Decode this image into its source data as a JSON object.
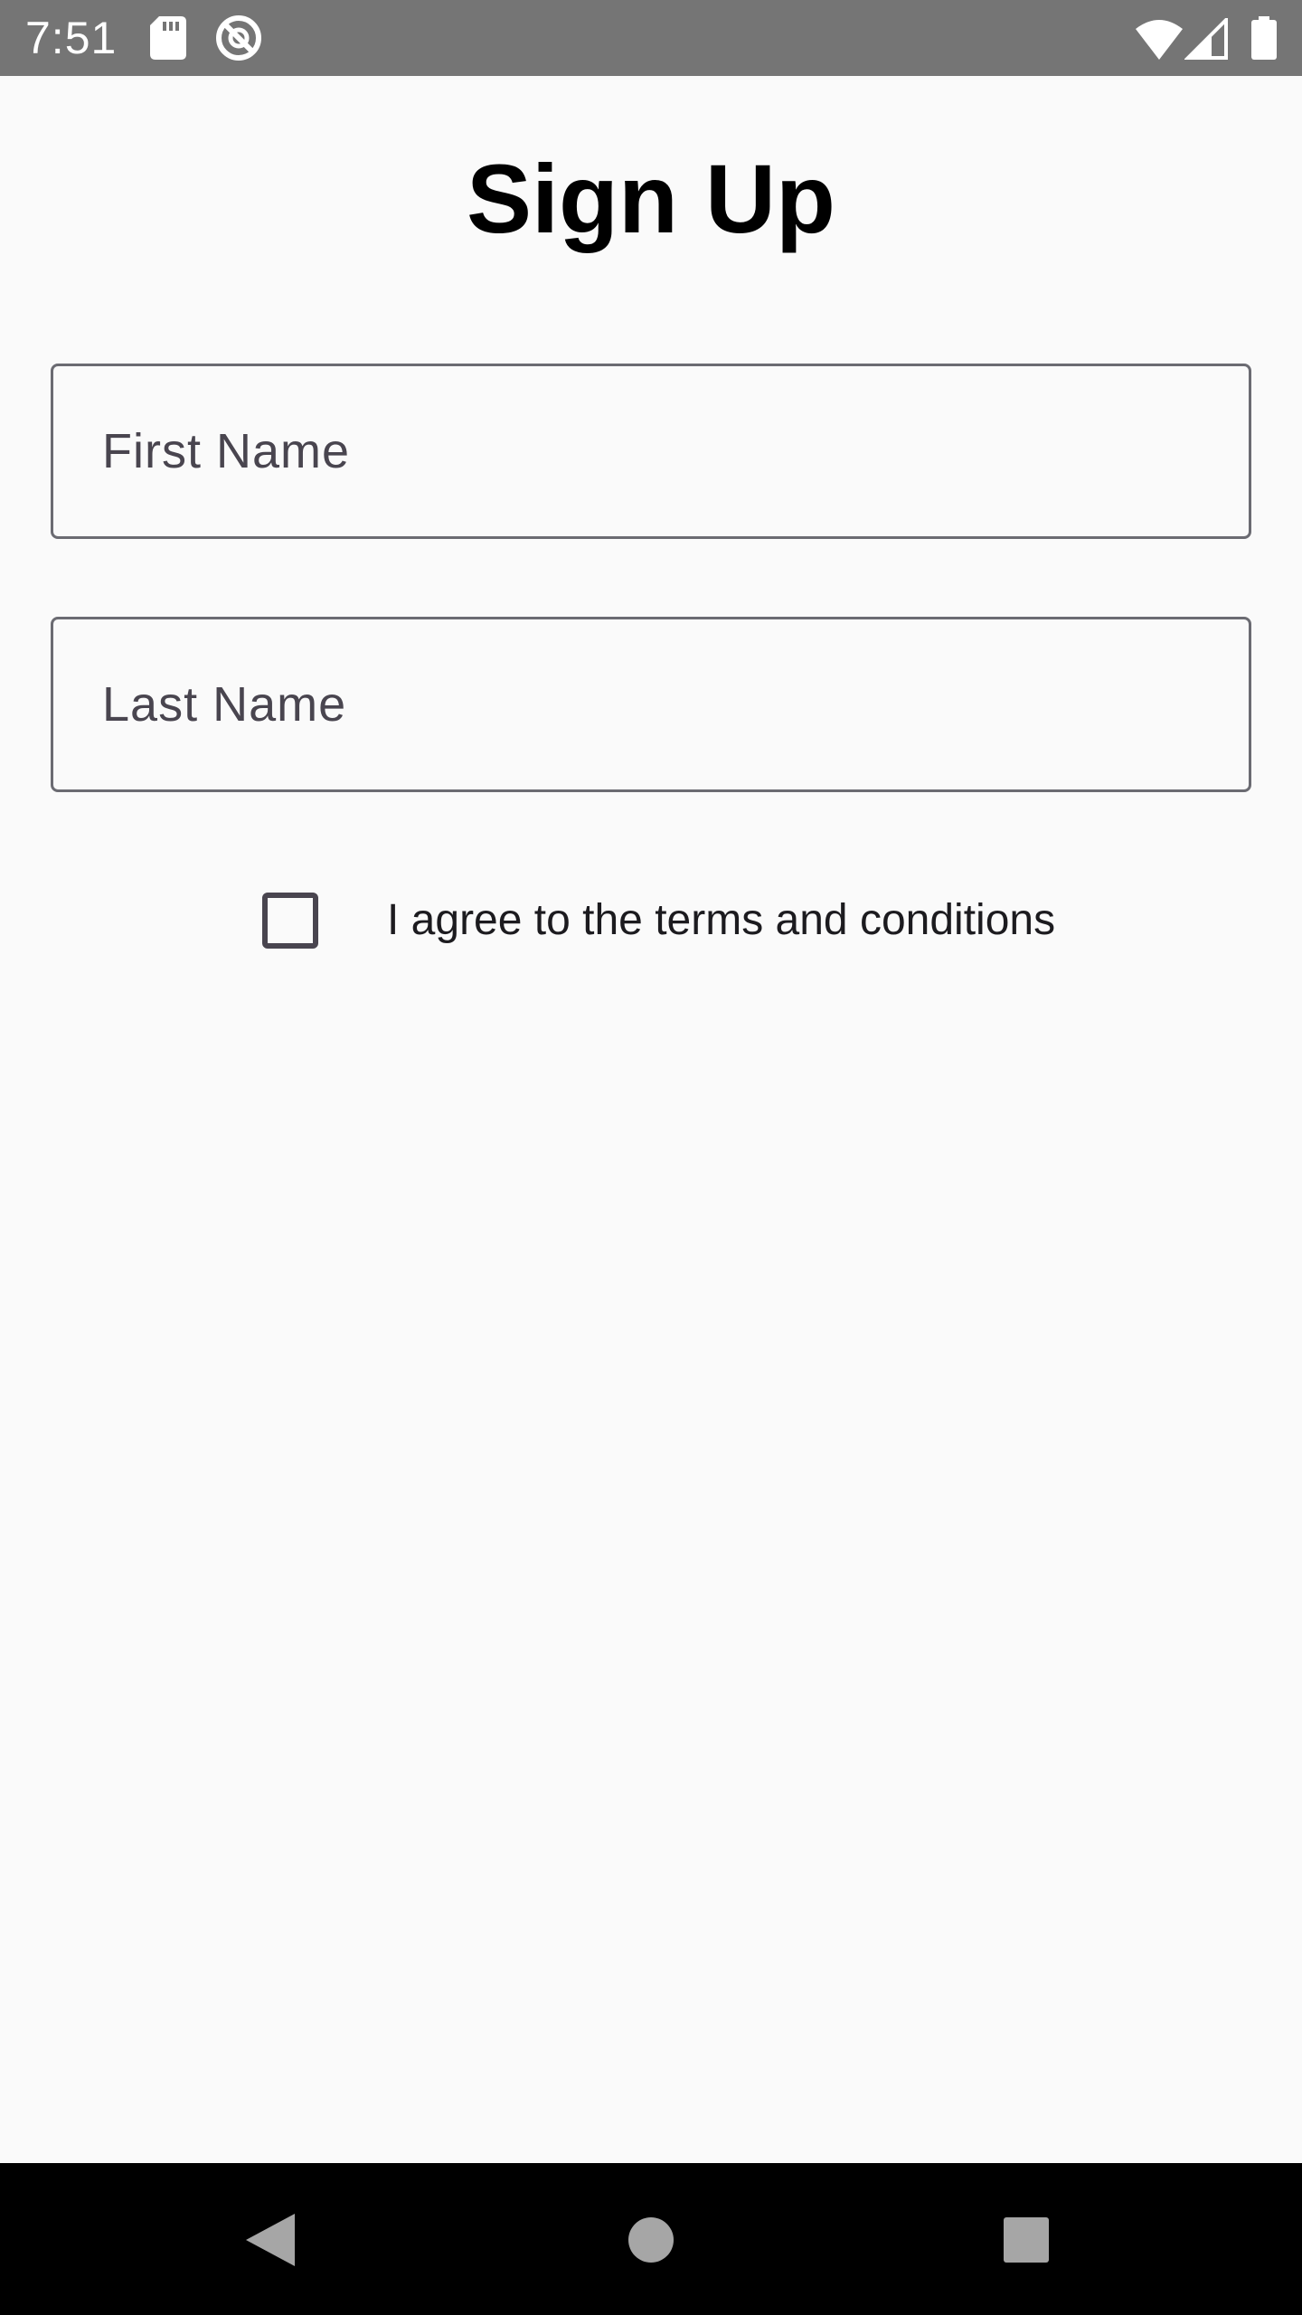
{
  "status_bar": {
    "time": "7:51",
    "icons": [
      "sd-card-icon",
      "sync-disabled-icon",
      "wifi-icon",
      "cell-signal-icon",
      "battery-icon"
    ]
  },
  "header": {
    "title": "Sign Up"
  },
  "form": {
    "first_name": {
      "placeholder": "First Name",
      "value": ""
    },
    "last_name": {
      "placeholder": "Last Name",
      "value": ""
    },
    "terms_checkbox": {
      "label": "I agree to the terms and conditions",
      "checked": false
    }
  },
  "navigation_bar": {
    "buttons": [
      "back-icon",
      "home-icon",
      "recents-icon"
    ]
  },
  "colors": {
    "background": "#fafafa",
    "status_bar": "#757575",
    "field_border": "#6b6b72",
    "text_primary": "#1c1b1f",
    "text_secondary": "#49454f",
    "nav_bar": "#000000"
  }
}
